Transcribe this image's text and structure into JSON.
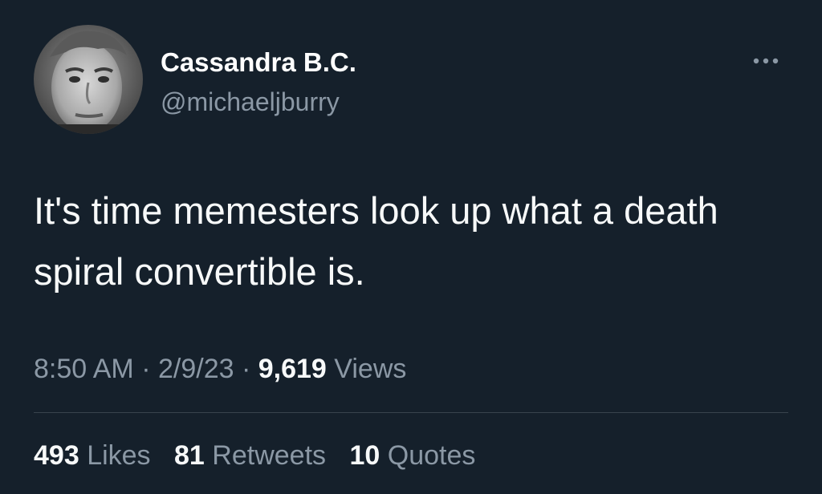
{
  "author": {
    "display_name": "Cassandra B.C.",
    "handle": "@michaeljburry"
  },
  "tweet": {
    "text": "It's time memesters look up what a death spiral convertible is."
  },
  "meta": {
    "time": "8:50 AM",
    "separator": "·",
    "date": "2/9/23",
    "views_count": "9,619",
    "views_label": "Views"
  },
  "stats": {
    "likes_count": "493",
    "likes_label": "Likes",
    "retweets_count": "81",
    "retweets_label": "Retweets",
    "quotes_count": "10",
    "quotes_label": "Quotes"
  },
  "icons": {
    "more": "more-horizontal-icon"
  },
  "colors": {
    "background": "#15202b",
    "primary_text": "#f7f9f9",
    "secondary_text": "#8b98a5",
    "divider": "#38444d"
  }
}
